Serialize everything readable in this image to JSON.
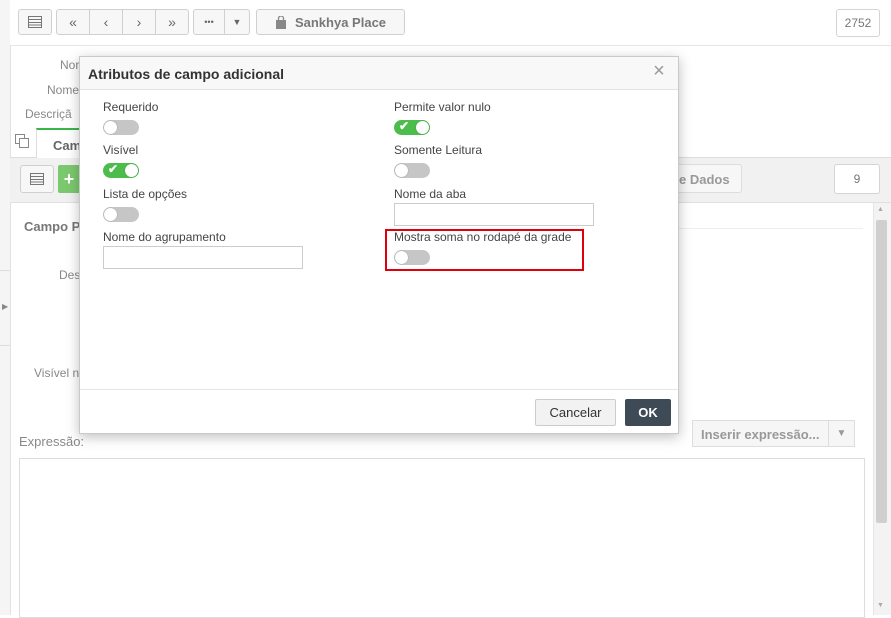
{
  "toolbar": {
    "place_label": "Sankhya Place",
    "record_count": "2752",
    "more_label": "•••"
  },
  "background_form": {
    "label_nome": "Nor",
    "label_nome2": "Nome",
    "label_descricao": "Descriçã",
    "tab_label": "Cam",
    "panel_title": "Campo P",
    "label_desc": "Des",
    "label_visivel": "Visível n",
    "dados_button": "e Dados",
    "item_count": "9",
    "expression_label": "Expressão:",
    "insert_expression": "Inserir expressão..."
  },
  "dialog": {
    "title": "Atributos de campo adicional",
    "fields": {
      "requerido": {
        "label": "Requerido",
        "value": false
      },
      "permite_nulo": {
        "label": "Permite valor nulo",
        "value": true
      },
      "visivel": {
        "label": "Visível",
        "value": true
      },
      "somente_leitura": {
        "label": "Somente Leitura",
        "value": false
      },
      "lista_opcoes": {
        "label": "Lista de opções",
        "value": false
      },
      "nome_aba": {
        "label": "Nome da aba",
        "value": ""
      },
      "nome_agrupamento": {
        "label": "Nome do agrupamento",
        "value": ""
      },
      "mostra_soma": {
        "label": "Mostra soma no rodapé da grade",
        "value": false
      }
    },
    "cancel_label": "Cancelar",
    "ok_label": "OK"
  },
  "colors": {
    "toggle_on": "#4cbd4c",
    "toggle_off": "#c6c6c6",
    "highlight": "#e0000c",
    "ok_button": "#3f4a57"
  }
}
